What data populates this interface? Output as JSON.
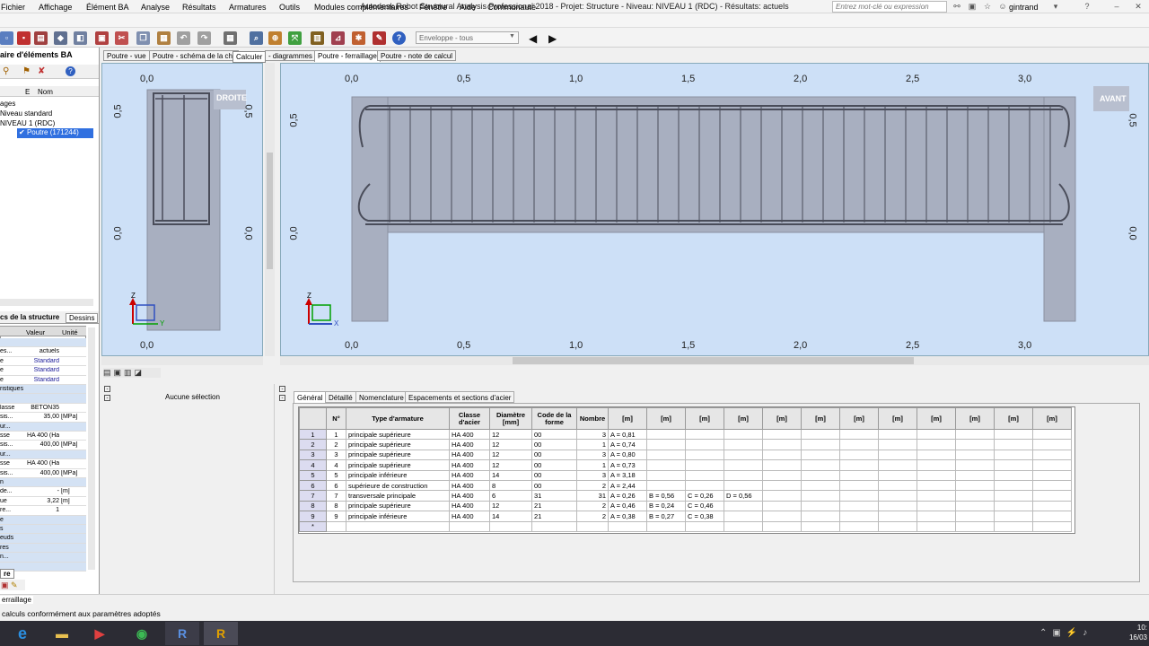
{
  "window": {
    "title": "Autodesk Robot Structural Analysis Professional 2018 - Projet: Structure - Niveau: NIVEAU 1 (RDC) - Résultats: actuels",
    "search_placeholder": "Entrez mot-clé ou expression",
    "user": "gintrand"
  },
  "menu": [
    "Fichier",
    "Affichage",
    "Élément BA",
    "Analyse",
    "Résultats",
    "Armatures",
    "Outils",
    "Modules complémentaires",
    "Fenêtre",
    "Aide",
    "Communauté"
  ],
  "toolbar": {
    "envelope": "Enveloppe - tous",
    "tooltip": "Calculer"
  },
  "left_panel": {
    "title": "aire d'éléments BA",
    "col_e": "E",
    "col_nom": "Nom",
    "tree": [
      "ages",
      "Niveau standard",
      "NIVEAU 1 (RDC)",
      "Poutre (171244)"
    ],
    "tabs": [
      "cs de la structure",
      "Dessins"
    ],
    "prop_headers": [
      "Valeur",
      "Unité"
    ],
    "props": [
      [
        "",
        "",
        ""
      ],
      [
        "es...",
        "actuels",
        ""
      ],
      [
        "e",
        "Standard",
        ""
      ],
      [
        "e",
        "Standard",
        ""
      ],
      [
        "e",
        "Standard",
        ""
      ],
      [
        "ristiques de matériau",
        "",
        ""
      ],
      [
        "",
        "",
        ""
      ],
      [
        "lasse",
        "BETON35",
        ""
      ],
      [
        "sis...",
        "35,00",
        "[MPa]"
      ],
      [
        "ur...",
        "",
        ""
      ],
      [
        "sse",
        "HA 400 (Ha...",
        ""
      ],
      [
        "sis...",
        "400,00",
        "[MPa]"
      ],
      [
        "ur...",
        "",
        ""
      ],
      [
        "sse",
        "HA 400 (Ha...",
        ""
      ],
      [
        "sis...",
        "400,00",
        "[MPa]"
      ],
      [
        "n",
        "",
        ""
      ],
      [
        "de...",
        "-",
        "[m]"
      ],
      [
        "ue",
        "3,22",
        "[m]"
      ],
      [
        "re...",
        "1",
        ""
      ],
      [
        "e",
        "",
        ""
      ],
      [
        "s",
        "",
        ""
      ],
      [
        "euds",
        "",
        ""
      ],
      [
        "res",
        "",
        ""
      ],
      [
        "n...",
        "",
        ""
      ],
      [
        "",
        "",
        ""
      ]
    ],
    "bottom_tab": "re"
  },
  "view_tabs": [
    "Poutre - vue",
    "Poutre - schéma de la cha",
    "- diagrammes",
    "Poutre - ferraillage",
    "Poutre - note de calcul"
  ],
  "views": {
    "left": {
      "label": "DROITE",
      "x_ticks": [
        "0,0",
        "0,0"
      ],
      "y_ticks": [
        "0,5",
        "0,0"
      ],
      "y_ticks_right": [
        "0,5",
        "0,0"
      ],
      "axis": [
        "Z",
        "Y"
      ]
    },
    "right": {
      "label": "AVANT",
      "x_ticks": [
        "0,0",
        "0,5",
        "1,0",
        "1,5",
        "2,0",
        "2,5",
        "3,0"
      ],
      "y_ticks": [
        "0,5",
        "0,0"
      ],
      "y_ticks_right": [
        "0,5",
        "0,0"
      ],
      "axis": [
        "Z",
        "X"
      ]
    }
  },
  "bottom": {
    "no_selection": "Aucune sélection",
    "tabs": [
      "Général",
      "Détaillé",
      "Nomenclature",
      "Espacements et sections d'acier"
    ],
    "headers": [
      "N°",
      "Type d'armature",
      "Classe d'acier",
      "Diamètre [mm]",
      "Code de la forme",
      "Nombre",
      "[m]",
      "[m]",
      "[m]",
      "[m]",
      "[m]",
      "[m]",
      "[m]",
      "[m]",
      "[m]",
      "[m]",
      "[m]",
      "[m]"
    ],
    "rows": [
      [
        "1",
        "principale supérieure",
        "HA 400",
        "12",
        "00",
        "3",
        "A = 0,81",
        "",
        "",
        ""
      ],
      [
        "2",
        "principale supérieure",
        "HA 400",
        "12",
        "00",
        "1",
        "A = 0,74",
        "",
        "",
        ""
      ],
      [
        "3",
        "principale supérieure",
        "HA 400",
        "12",
        "00",
        "3",
        "A = 0,80",
        "",
        "",
        ""
      ],
      [
        "4",
        "principale supérieure",
        "HA 400",
        "12",
        "00",
        "1",
        "A = 0,73",
        "",
        "",
        ""
      ],
      [
        "5",
        "principale inférieure",
        "HA 400",
        "14",
        "00",
        "3",
        "A = 3,18",
        "",
        "",
        ""
      ],
      [
        "6",
        "supérieure de construction",
        "HA 400",
        "8",
        "00",
        "2",
        "A = 2,44",
        "",
        "",
        ""
      ],
      [
        "7",
        "transversale principale",
        "HA 400",
        "6",
        "31",
        "31",
        "A = 0,26",
        "B = 0,56",
        "C = 0,26",
        "D = 0,56"
      ],
      [
        "8",
        "principale supérieure",
        "HA 400",
        "12",
        "21",
        "2",
        "A = 0,46",
        "B = 0,24",
        "C = 0,46",
        ""
      ],
      [
        "9",
        "principale inférieure",
        "HA 400",
        "14",
        "21",
        "2",
        "A = 0,38",
        "B = 0,27",
        "C = 0,38",
        ""
      ]
    ],
    "new_row_marker": "*"
  },
  "status": {
    "line1": "erraillage",
    "line2": "calculs conformément aux paramètres adoptés",
    "clock_time": "10:",
    "clock_date": "16/03"
  },
  "taskbar": [
    {
      "name": "ie-icon",
      "glyph": "e",
      "color": "#2b8fe0"
    },
    {
      "name": "folder-icon",
      "glyph": "▬",
      "color": "#e8c050"
    },
    {
      "name": "media-icon",
      "glyph": "▶",
      "color": "#e04040"
    },
    {
      "name": "chrome-icon",
      "glyph": "◉",
      "color": "#3cba54"
    },
    {
      "name": "robot-icon",
      "glyph": "R",
      "color": "#3a5fa8"
    },
    {
      "name": "revit-icon",
      "glyph": "R",
      "color": "#e0a000"
    }
  ]
}
